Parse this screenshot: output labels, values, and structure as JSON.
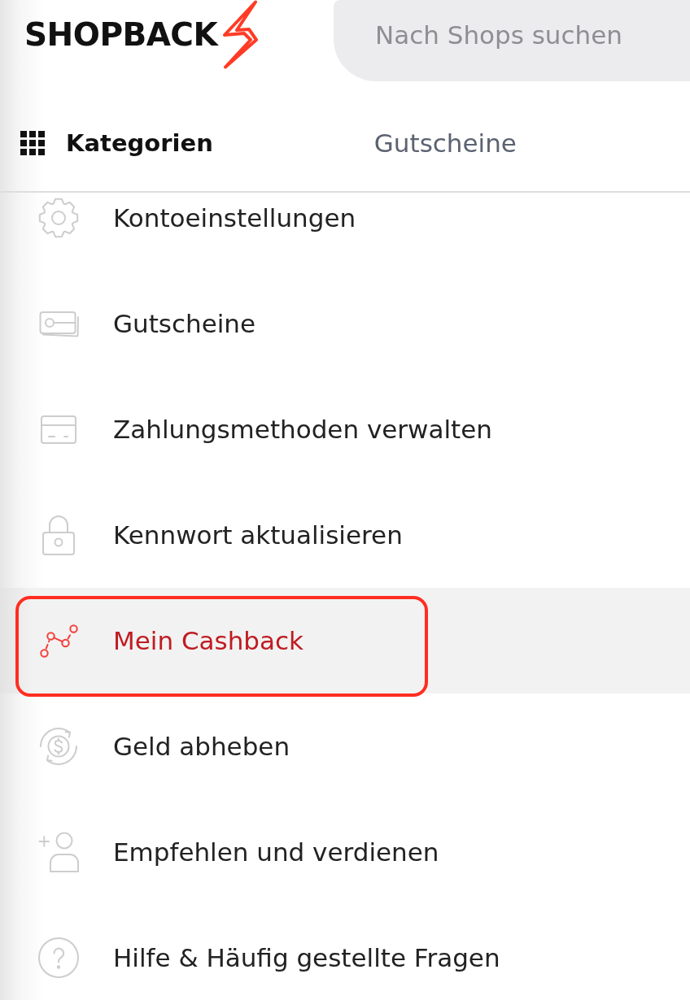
{
  "header": {
    "logo": {
      "text": "SHOPBACK"
    },
    "search": {
      "placeholder": "Nach Shops suchen"
    }
  },
  "nav": [
    {
      "kind": "categories",
      "label": "Kategorien"
    },
    {
      "kind": "link",
      "label": "Gutscheine"
    }
  ],
  "menu": {
    "items": [
      {
        "kind": "settings",
        "label": "Kontoeinstellungen",
        "selected": false,
        "highlighted": false
      },
      {
        "kind": "voucher",
        "label": "Gutscheine",
        "selected": false,
        "highlighted": false
      },
      {
        "kind": "card",
        "label": "Zahlungsmethoden verwalten",
        "selected": false,
        "highlighted": false
      },
      {
        "kind": "lock",
        "label": "Kennwort aktualisieren",
        "selected": false,
        "highlighted": false
      },
      {
        "kind": "chart",
        "label": "Mein Cashback",
        "selected": true,
        "highlighted": true
      },
      {
        "kind": "withdraw",
        "label": "Geld abheben",
        "selected": false,
        "highlighted": false
      },
      {
        "kind": "referral",
        "label": "Empfehlen und verdienen",
        "selected": false,
        "highlighted": false
      },
      {
        "kind": "help",
        "label": "Hilfe & Häufig gestellte Fragen",
        "selected": false,
        "highlighted": false
      }
    ]
  }
}
